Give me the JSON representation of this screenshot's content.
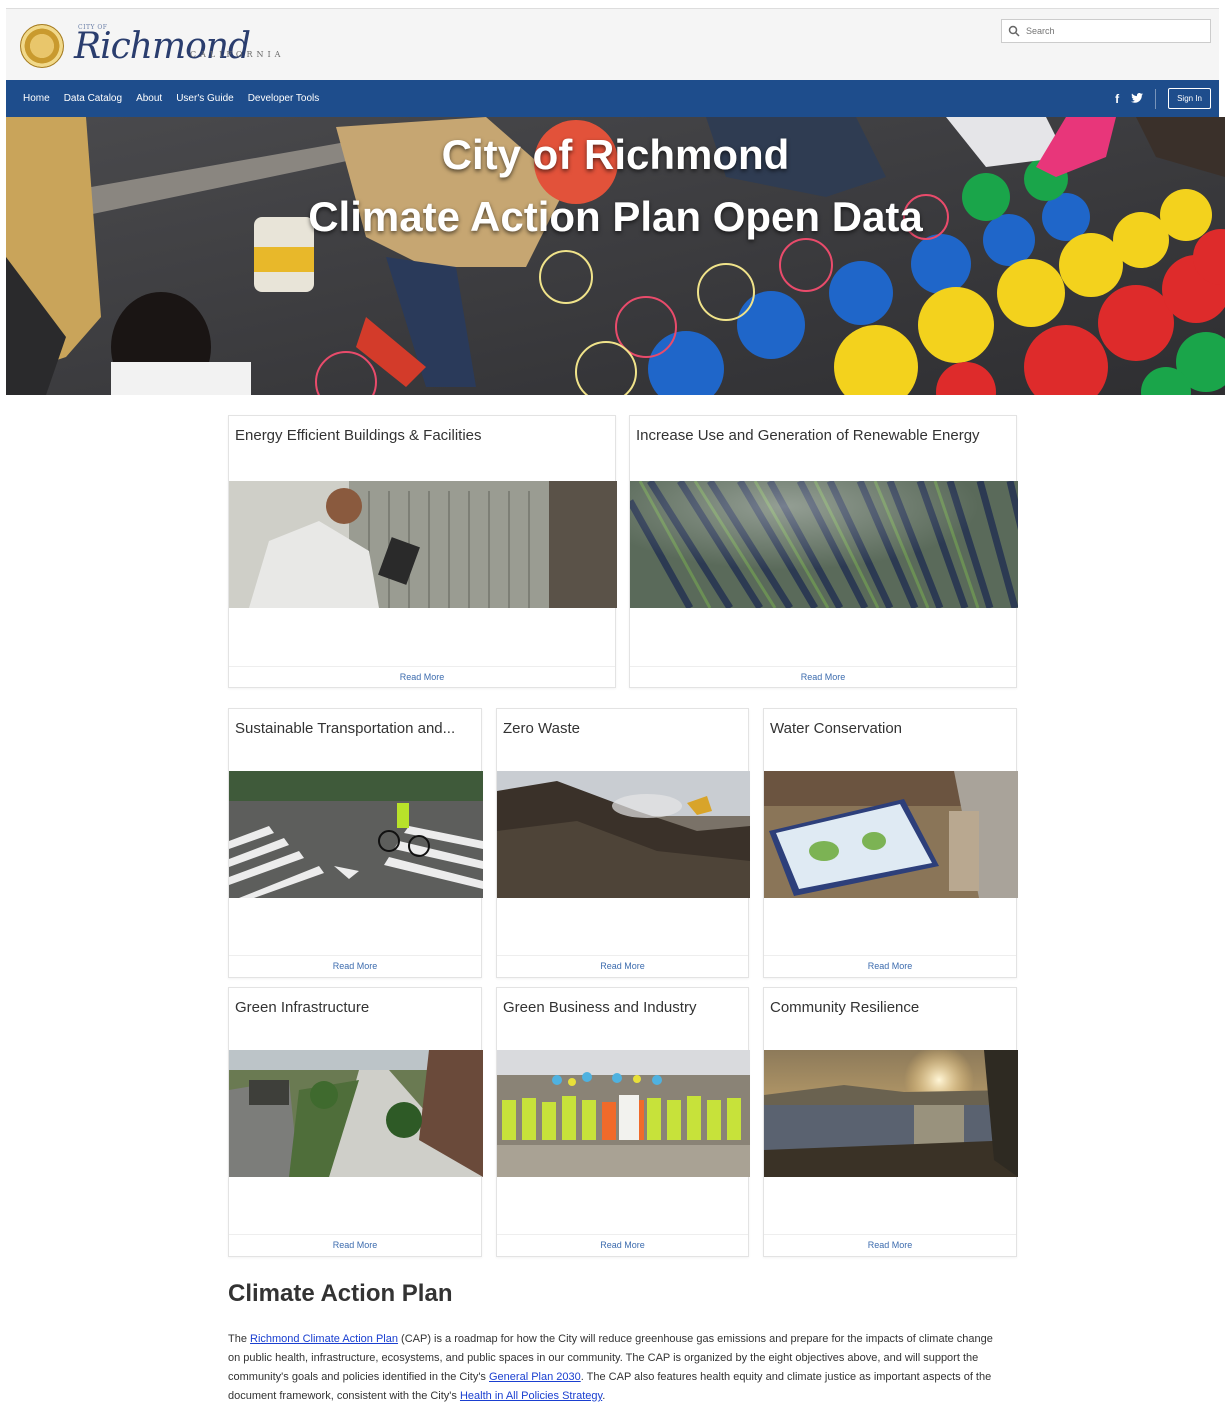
{
  "header": {
    "logo_small": "CITY OF",
    "logo_script": "Richmond",
    "logo_state": "CALIFORNIA",
    "search_placeholder": "Search"
  },
  "nav": {
    "items": [
      "Home",
      "Data Catalog",
      "About",
      "User's Guide",
      "Developer Tools"
    ],
    "facebook": "f",
    "twitter": "t",
    "signin": "Sign In"
  },
  "hero": {
    "title_line1": "City of Richmond",
    "title_line2": "Climate Action Plan Open Data"
  },
  "cards": [
    {
      "title": "Energy Efficient Buildings & Facilities",
      "read_more": "Read More",
      "image": "hvac-technician"
    },
    {
      "title": "Increase Use and Generation of Renewable Energy",
      "read_more": "Read More",
      "image": "solar-farm"
    },
    {
      "title": "Sustainable Transportation and...",
      "read_more": "Read More",
      "image": "cyclist-crosswalk"
    },
    {
      "title": "Zero Waste",
      "read_more": "Read More",
      "image": "compost-pile"
    },
    {
      "title": "Water Conservation",
      "read_more": "Read More",
      "image": "interpretive-sign"
    },
    {
      "title": "Green Infrastructure",
      "read_more": "Read More",
      "image": "green-street"
    },
    {
      "title": "Green Business and Industry",
      "read_more": "Read More",
      "image": "workers-group"
    },
    {
      "title": "Community Resilience",
      "read_more": "Read More",
      "image": "sunset-shoreline"
    }
  ],
  "section": {
    "title": "Climate Action Plan",
    "p_the": "The ",
    "link_cap": "Richmond Climate Action Plan",
    "p_1": " (CAP) is a roadmap for how the City will reduce greenhouse gas emissions and prepare for the impacts of climate change on public health, infrastructure, ecosystems, and public spaces in our community. The CAP is organized by the eight objectives above, and will support the community's goals and policies identified in the City's ",
    "link_gp": "General Plan 2030",
    "p_2": ". The CAP also features health equity and climate justice as important aspects of the document framework, consistent with the City's ",
    "link_hiap": "Health in All Policies Strategy",
    "p_3": "."
  },
  "colors": {
    "nav_bg": "#1e4d8c",
    "link": "#3d6cae",
    "body_link": "#1a3fd0"
  }
}
